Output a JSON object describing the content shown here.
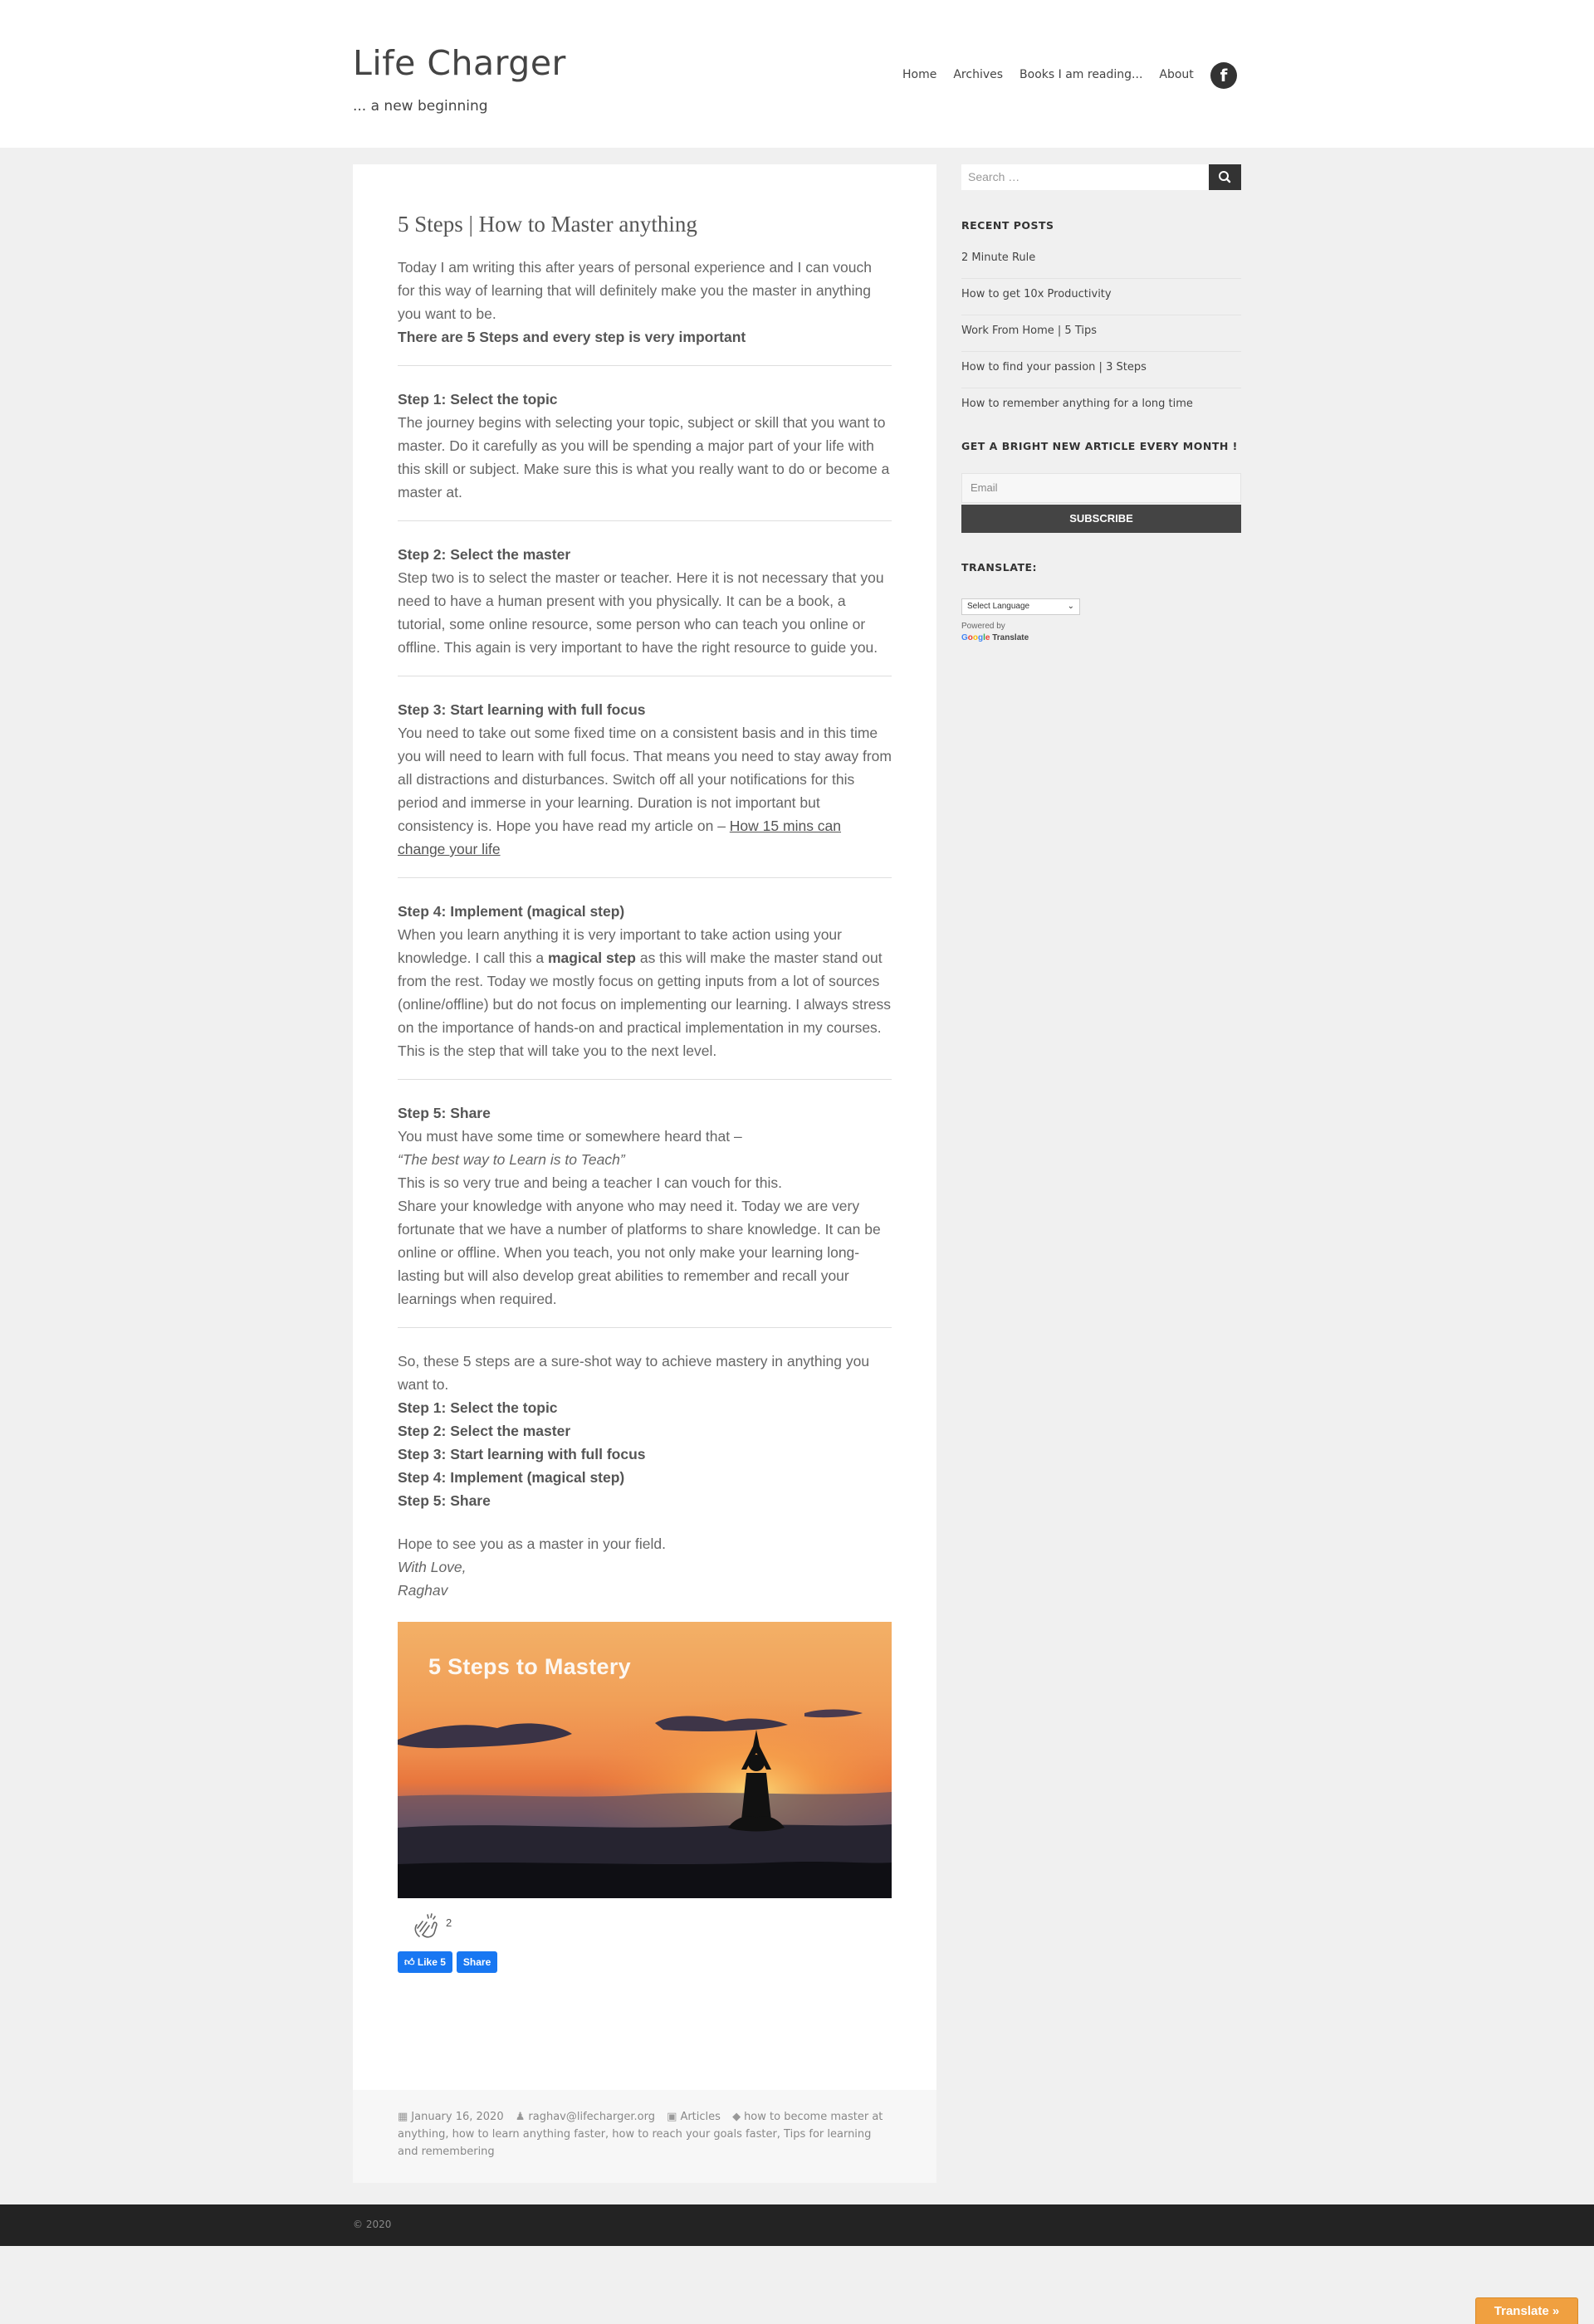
{
  "site": {
    "title": "Life Charger",
    "tagline": "... a new beginning"
  },
  "nav": {
    "items": [
      "Home",
      "Archives",
      "Books I am reading...",
      "About"
    ],
    "social_icon": "facebook-icon",
    "social_glyph": "f"
  },
  "post": {
    "title": "5 Steps | How to Master anything",
    "intro": "Today I am writing this after years of personal experience and I can vouch for this way of learning that will definitely make you the master in anything you want to be.",
    "intro_bold": "There are 5 Steps and every step is very important",
    "steps": [
      {
        "heading": "Step 1: Select the topic",
        "body": "The journey begins with selecting your topic, subject or skill that you want to master. Do it carefully as you will be spending a major part of your life with this skill or subject. Make sure this is what you really want to do or become a master at."
      },
      {
        "heading": "Step 2: Select the master",
        "body": "Step two is to select the master or teacher. Here it is not necessary that you need to have a human present with you physically. It can be a book, a tutorial, some online resource, some person who can teach you online or offline. This again is very important to have the right resource to guide you."
      },
      {
        "heading": "Step 3: Start learning with full focus",
        "body": "You need to take out some fixed time on a consistent basis and in this time you will need to learn with full focus. That means you need to stay away from all distractions and disturbances. Switch off all your notifications for this period and immerse in your learning. Duration is not important but consistency is. Hope you have read my article on – ",
        "link": "How 15 mins can change your life"
      },
      {
        "heading": "Step 4: Implement (magical step)",
        "body_before": "When you learn anything it is very important to take action using your knowledge. I call this a ",
        "body_bold": "magical step",
        "body_after": " as this will make the master stand out from the rest. Today we mostly focus on getting inputs from a lot of sources (online/offline) but do not focus on implementing our learning. I always stress on the importance of hands-on and practical implementation in my courses. This is the step that will take you to the next level."
      },
      {
        "heading": "Step 5: Share",
        "line1": "You must have some time or somewhere heard that –",
        "quote": "“The best way to Learn is to Teach”",
        "line2": "This is so very true and being a teacher I can vouch for this.",
        "body": "Share your knowledge with anyone who may need it. Today we are very fortunate that we have a number of platforms to share knowledge. It can be online or offline. When you teach, you not only make your learning long-lasting but will also develop great abilities to remember and recall your learnings when required."
      }
    ],
    "summary_intro": "So, these 5 steps are a sure-shot way to achieve mastery in anything you want to.",
    "summary_steps": [
      "Step 1: Select the topic",
      "Step 2: Select the master",
      "Step 3: Start learning with full focus",
      "Step 4: Implement (magical step)",
      "Step 5: Share"
    ],
    "closing": "Hope to see you as a master in your field.",
    "signoff": "With Love,",
    "author_sign": "Raghav",
    "hero_caption": "5 Steps to Mastery",
    "claps": "2",
    "fb_like": "Like 5",
    "fb_share": "Share",
    "meta": {
      "date": "January 16, 2020",
      "author": "raghav@lifecharger.org",
      "category": "Articles",
      "tags": "how to become master at anything, how to learn anything faster, how to reach your goals faster, Tips for learning and remembering"
    }
  },
  "sidebar": {
    "search_placeholder": "Search …",
    "recent_title": "RECENT POSTS",
    "recent_posts": [
      "2 Minute Rule",
      "How to get 10x Productivity",
      "Work From Home | 5 Tips",
      "How to find your passion | 3 Steps",
      "How to remember anything for a long time"
    ],
    "subscribe_title": "GET A BRIGHT NEW ARTICLE EVERY MONTH !",
    "email_placeholder": "Email",
    "subscribe_label": "SUBSCRIBE",
    "translate_title": "TRANSLATE:",
    "language_select": "Select Language",
    "powered_by": "Powered by",
    "google": "Google",
    "translate_word": "Translate"
  },
  "footer": {
    "copyright": "© 2020",
    "translate_tab": "Translate »"
  },
  "colors": {
    "facebook_blue": "#1877f2",
    "translate_orange": "#f0a040",
    "footer_bg": "#232323"
  }
}
